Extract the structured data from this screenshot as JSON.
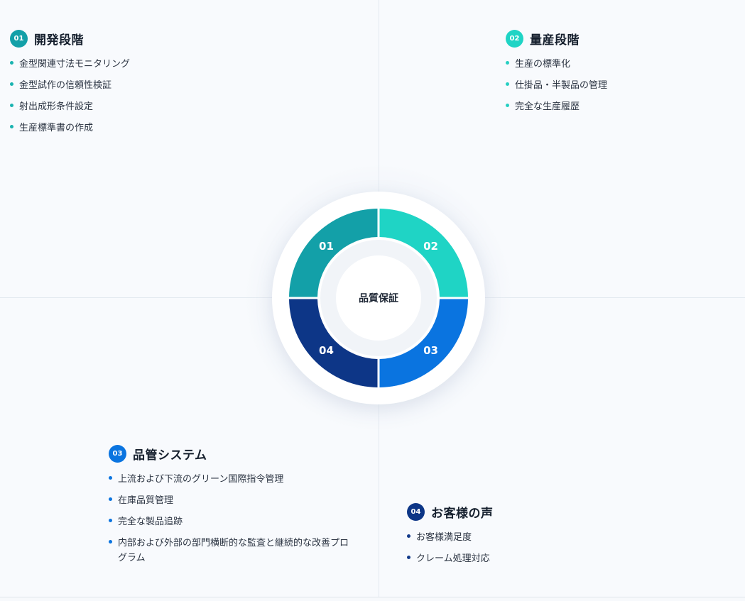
{
  "colors": {
    "q1": "#13a0a8",
    "q2": "#1fd4c5",
    "q3": "#0a74e0",
    "q4": "#0d3687",
    "q1_bullet": "#19b3b0",
    "q2_bullet": "#26cfc2",
    "q3_bullet": "#0b74df",
    "q4_bullet": "#123a8a"
  },
  "center": {
    "label": "品質保証"
  },
  "segments": [
    {
      "id": "01",
      "position": "top-left"
    },
    {
      "id": "02",
      "position": "top-right"
    },
    {
      "id": "03",
      "position": "bottom-right"
    },
    {
      "id": "04",
      "position": "bottom-left"
    }
  ],
  "quadrants": {
    "q1": {
      "number": "01",
      "title": "開発段階",
      "items": [
        "金型関連寸法モニタリング",
        "金型試作の信頼性検証",
        "射出成形条件設定",
        "生産標準書の作成"
      ]
    },
    "q2": {
      "number": "02",
      "title": "量産段階",
      "items": [
        "生産の標準化",
        "仕掛品・半製品の管理",
        "完全な生産履歴"
      ]
    },
    "q3": {
      "number": "03",
      "title": "品管システム",
      "items": [
        "上流および下流のグリーン国際指令管理",
        "在庫品質管理",
        "完全な製品追跡",
        "内部および外部の部門横断的な監査と継続的な改善プログラム"
      ]
    },
    "q4": {
      "number": "04",
      "title": "お客様の声",
      "items": [
        "お客様満足度",
        "クレーム処理対応"
      ]
    }
  }
}
